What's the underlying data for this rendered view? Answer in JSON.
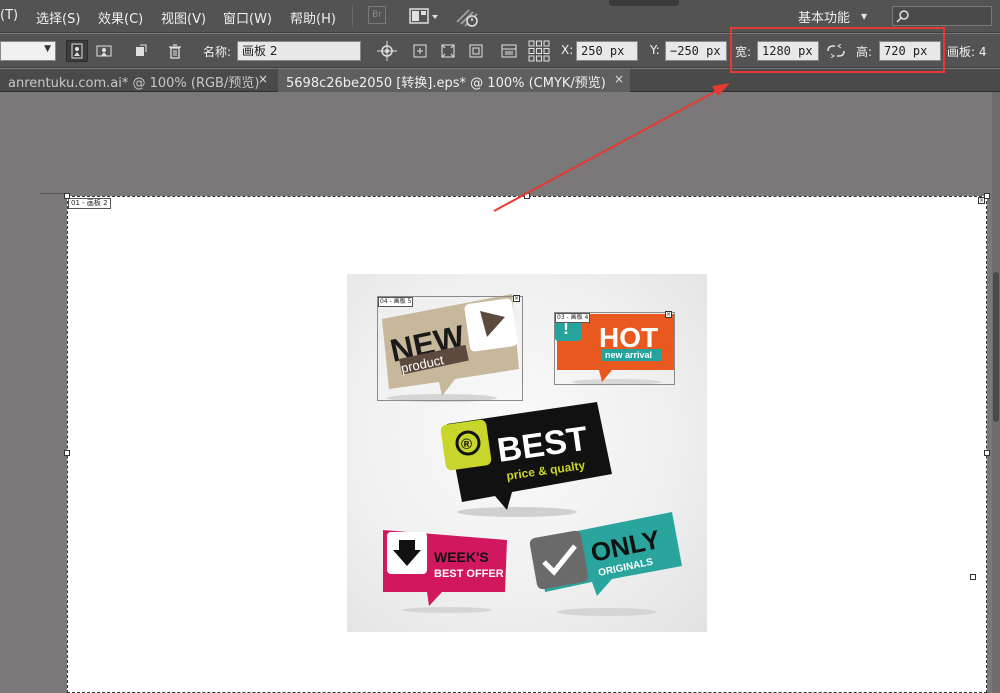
{
  "menu": {
    "items": [
      "(T)",
      "选择(S)",
      "效果(C)",
      "视图(V)",
      "窗口(W)",
      "帮助(H)"
    ],
    "bridge_label": "Br",
    "workspace": "基本功能"
  },
  "control": {
    "name_label": "名称:",
    "name_value": "画板 2",
    "x_label": "X:",
    "x_value": "250 px",
    "y_label": "Y:",
    "y_value": "−250 px",
    "width_label": "宽:",
    "width_value": "1280 px",
    "height_label": "高:",
    "height_value": "720 px",
    "artboards_label": "画板: 4"
  },
  "tabs": [
    {
      "label": "anrentuku.com.ai* @ 100% (RGB/预览)",
      "close": "×",
      "active": false
    },
    {
      "label": "5698c26be2050 [转换].eps* @ 100% (CMYK/预览)",
      "close": "×",
      "active": true
    }
  ],
  "artboard": {
    "label": "01 - 画板 2"
  },
  "image": {
    "sub_artboards": [
      "04 - 画板 5",
      "03 - 画板 4"
    ],
    "stickers": {
      "new": {
        "title": "NEW",
        "sub": "product"
      },
      "hot": {
        "title": "HOT",
        "sub": "new arrival",
        "mark": "!"
      },
      "best": {
        "title": "BEST",
        "sub": "price & qualty",
        "mark": "®"
      },
      "week": {
        "title": "WEEK'S",
        "sub": "BEST OFFER"
      },
      "only": {
        "title": "ONLY",
        "sub": "ORIGINALS"
      }
    }
  },
  "colors": {
    "highlight": "#e53a33",
    "new_bg": "#c7b79b",
    "hot_bg": "#e9591f",
    "hot_tab": "#23a39b",
    "best_bg": "#111111",
    "best_accent": "#c8d62b",
    "week_bg": "#d1185f",
    "only_bg": "#2aa59d",
    "only_tab": "#6a6a6a"
  }
}
